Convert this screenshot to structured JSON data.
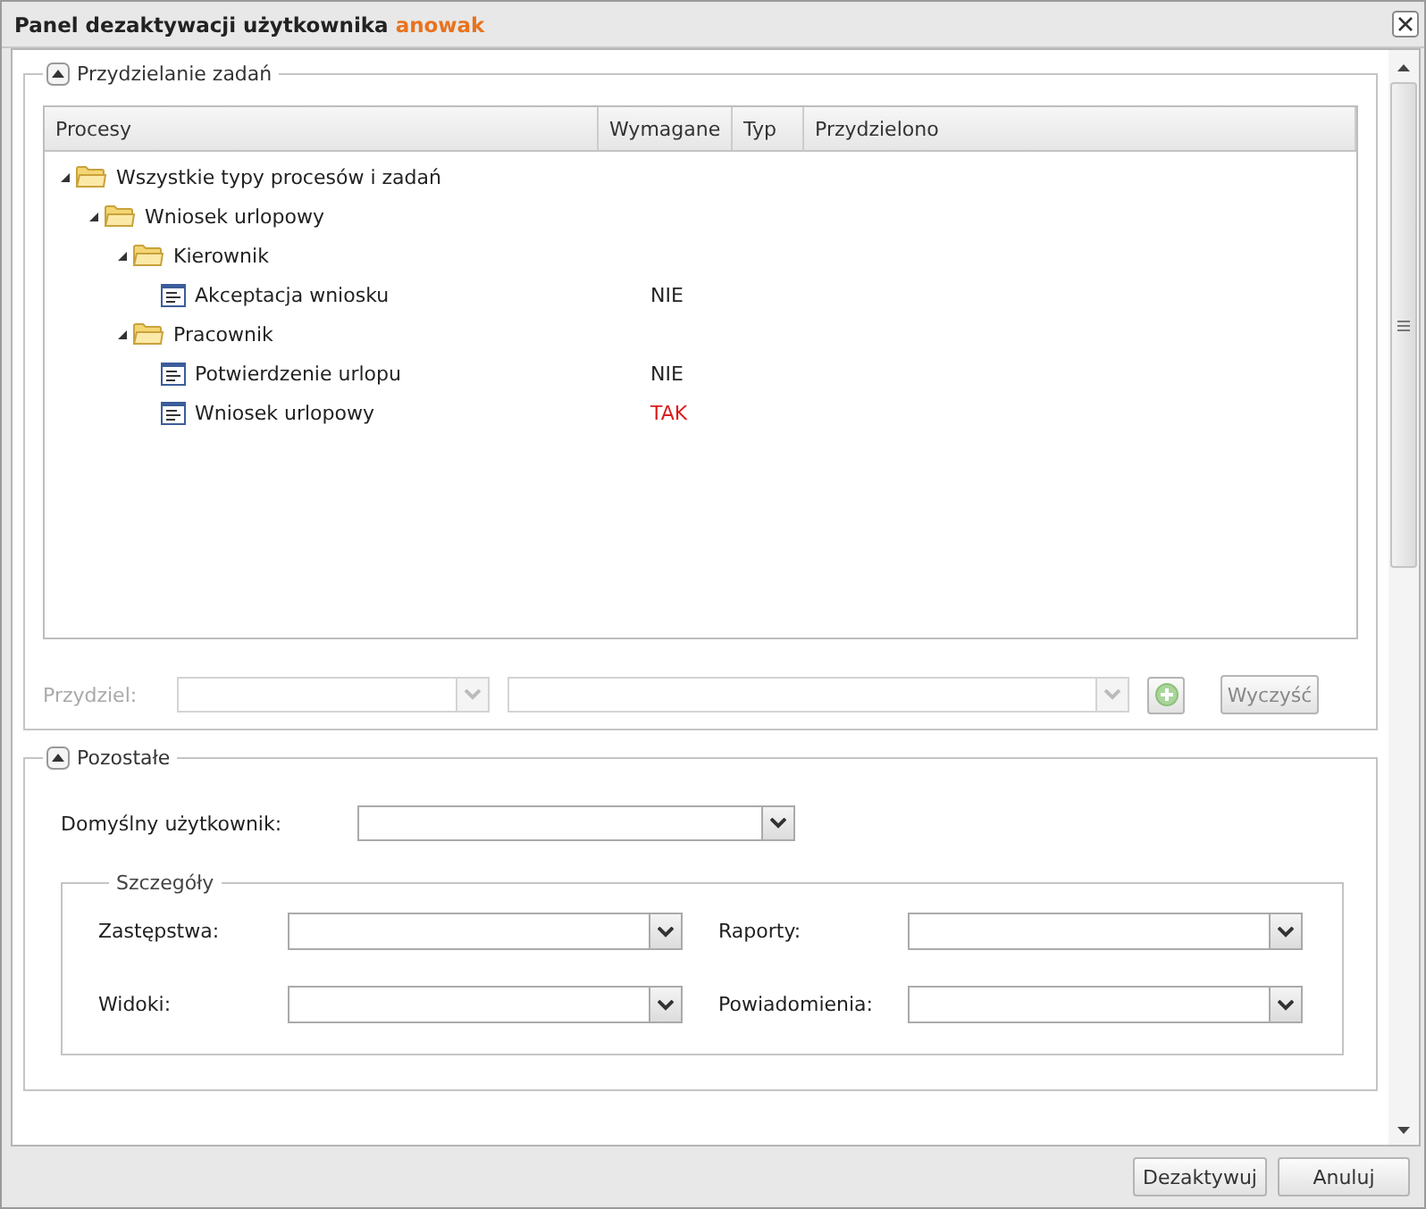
{
  "window": {
    "title": "Panel dezaktywacji użytkownika",
    "user": "anowak"
  },
  "assignment_section": {
    "legend": "Przydzielanie zadań",
    "expanded": true,
    "columns": [
      "Procesy",
      "Wymagane",
      "Typ",
      "Przydzielono"
    ],
    "tree": [
      {
        "kind": "folder",
        "label": "Wszystkie typy procesów i zadań",
        "expanded": true,
        "children": [
          {
            "kind": "folder",
            "label": "Wniosek urlopowy",
            "expanded": true,
            "children": [
              {
                "kind": "folder",
                "label": "Kierownik",
                "expanded": true,
                "children": [
                  {
                    "kind": "task",
                    "label": "Akceptacja wniosku",
                    "required": "NIE",
                    "alert": false
                  }
                ]
              },
              {
                "kind": "folder",
                "label": "Pracownik",
                "expanded": true,
                "children": [
                  {
                    "kind": "task",
                    "label": "Potwierdzenie urlopu",
                    "required": "NIE",
                    "alert": false
                  },
                  {
                    "kind": "task",
                    "label": "Wniosek urlopowy",
                    "required": "TAK",
                    "alert": true
                  }
                ]
              }
            ]
          }
        ]
      }
    ],
    "assign_row": {
      "label": "Przydziel:",
      "disabled": true,
      "clear_button": "Wyczyść"
    }
  },
  "other_section": {
    "legend": "Pozostałe",
    "expanded": true,
    "default_user": {
      "label": "Domyślny użytkownik:"
    },
    "details": {
      "legend": "Szczegóły",
      "fields": [
        {
          "label": "Zastępstwa:"
        },
        {
          "label": "Raporty:"
        },
        {
          "label": "Widoki:"
        },
        {
          "label": "Powiadomienia:"
        }
      ]
    }
  },
  "buttons": [
    "Dezaktywuj",
    "Anuluj"
  ]
}
